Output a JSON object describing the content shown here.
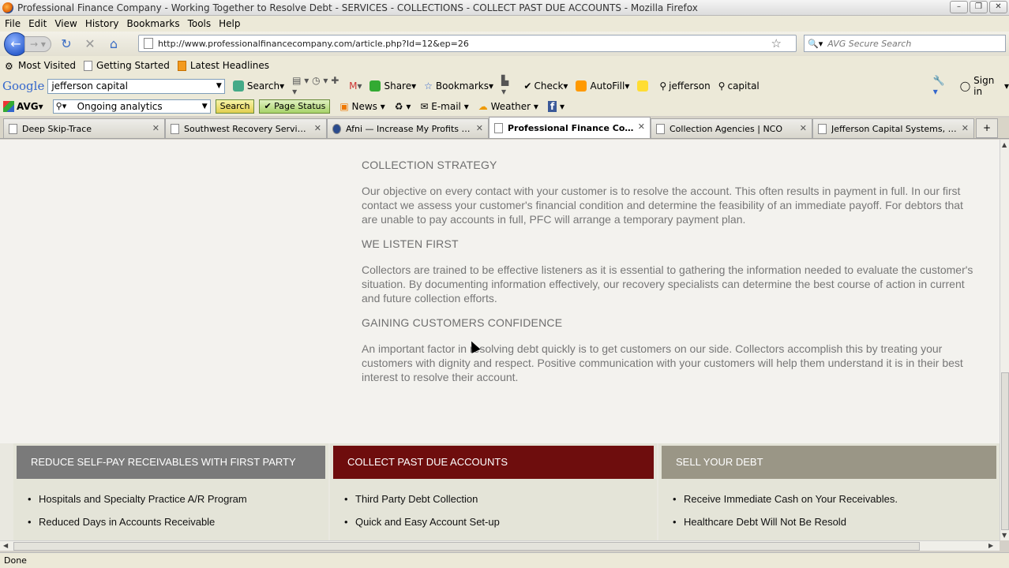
{
  "window": {
    "title": "Professional Finance Company - Working Together to Resolve Debt - SERVICES - COLLECTIONS - COLLECT PAST DUE ACCOUNTS - Mozilla Firefox"
  },
  "menu": [
    "File",
    "Edit",
    "View",
    "History",
    "Bookmarks",
    "Tools",
    "Help"
  ],
  "nav": {
    "url": "http://www.professionalfinancecompany.com/article.php?Id=12&ep=26",
    "search_placeholder": "AVG Secure Search"
  },
  "bookmarks": [
    "Most Visited",
    "Getting Started",
    "Latest Headlines"
  ],
  "google_toolbar": {
    "logo": "Google",
    "query": "jefferson capital",
    "search": "Search",
    "share": "Share",
    "bookmarks": "Bookmarks",
    "check": "Check",
    "autofill": "AutoFill",
    "term1": "jefferson",
    "term2": "capital",
    "signin": "Sign in"
  },
  "avg_toolbar": {
    "logo": "AVG",
    "query": "Ongoing analytics",
    "search_btn": "Search",
    "page_status": "Page Status",
    "news": "News",
    "email": "E-mail",
    "weather": "Weather"
  },
  "tabs": [
    {
      "label": "Deep Skip-Trace",
      "active": false
    },
    {
      "label": "Southwest Recovery Services, ...",
      "active": false
    },
    {
      "label": "Afni — Increase My Profits & ...",
      "active": false
    },
    {
      "label": "Professional Finance Compa...",
      "active": true
    },
    {
      "label": "Collection Agencies | NCO",
      "active": false
    },
    {
      "label": "Jefferson Capital Systems, LL...",
      "active": false
    }
  ],
  "article": {
    "h1": "COLLECTION STRATEGY",
    "p1": "Our objective on every contact with your customer is to resolve the account. This often results in payment in full. In our first contact we assess your customer's financial condition and determine the feasibility of an immediate payoff. For debtors that are unable to pay accounts in full, PFC will arrange  a  temporary payment  plan.",
    "h2": "WE LISTEN FIRST",
    "p2": "Collectors are trained to be effective listeners as it is essential to gathering the information needed to evaluate the customer's situation. By documenting information effectively, our recovery specialists can determine the best course of action in current and future collection efforts.",
    "h3": "GAINING CUSTOMERS CONFIDENCE",
    "p3": "An important factor in resolving debt quickly is to get customers on our side. Collectors accomplish this by treating your customers with dignity and respect. Positive communication with your customers will help them understand it is in their best interest to resolve their account."
  },
  "panels": [
    {
      "title": "REDUCE SELF-PAY RECEIVABLES WITH FIRST PARTY",
      "color": "#7a7a7a",
      "items": [
        "Hospitals and Specialty Practice A/R Program",
        "Reduced Days in Accounts Receivable"
      ]
    },
    {
      "title": "COLLECT PAST DUE ACCOUNTS",
      "color": "#6e0d0d",
      "items": [
        "Third Party Debt Collection",
        "Quick and Easy Account Set-up"
      ]
    },
    {
      "title": "SELL YOUR DEBT",
      "color": "#9a9686",
      "items": [
        "Receive Immediate Cash on Your Receivables.",
        " Healthcare Debt Will Not Be Resold"
      ]
    }
  ],
  "status": "Done"
}
